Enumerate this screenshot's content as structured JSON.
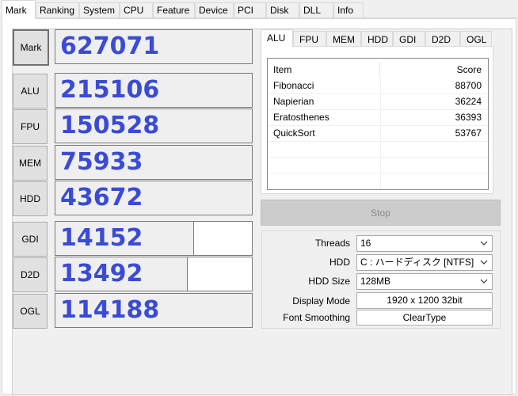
{
  "tabs": [
    "Mark",
    "Ranking",
    "System",
    "CPU",
    "Feature",
    "Device",
    "PCI",
    "Disk",
    "DLL",
    "Info"
  ],
  "scores": [
    {
      "label": "Mark",
      "value": "627071",
      "fill": 1.0
    },
    {
      "label": "ALU",
      "value": "215106",
      "fill": 1.0
    },
    {
      "label": "FPU",
      "value": "150528",
      "fill": 1.0
    },
    {
      "label": "MEM",
      "value": "75933",
      "fill": 1.0
    },
    {
      "label": "HDD",
      "value": "43672",
      "fill": 1.0
    },
    {
      "label": "GDI",
      "value": "14152",
      "fill": 0.7
    },
    {
      "label": "D2D",
      "value": "13492",
      "fill": 0.67
    },
    {
      "label": "OGL",
      "value": "114188",
      "fill": 1.0
    }
  ],
  "detail": {
    "tabs": [
      "ALU",
      "FPU",
      "MEM",
      "HDD",
      "GDI",
      "D2D",
      "OGL"
    ],
    "columns": {
      "item": "Item",
      "score": "Score"
    },
    "rows": [
      {
        "item": "Fibonacci",
        "score": "88700"
      },
      {
        "item": "Napierian",
        "score": "36224"
      },
      {
        "item": "Eratosthenes",
        "score": "36393"
      },
      {
        "item": "QuickSort",
        "score": "53767"
      }
    ]
  },
  "stop_label": "Stop",
  "settings": {
    "threads": {
      "label": "Threads",
      "value": "16"
    },
    "hdd": {
      "label": "HDD",
      "value": "C : ハードディスク [NTFS]"
    },
    "hdd_size": {
      "label": "HDD Size",
      "value": "128MB"
    },
    "display_mode": {
      "label": "Display Mode",
      "value": "1920 x 1200 32bit"
    },
    "font_smoothing": {
      "label": "Font Smoothing",
      "value": "ClearType"
    }
  }
}
